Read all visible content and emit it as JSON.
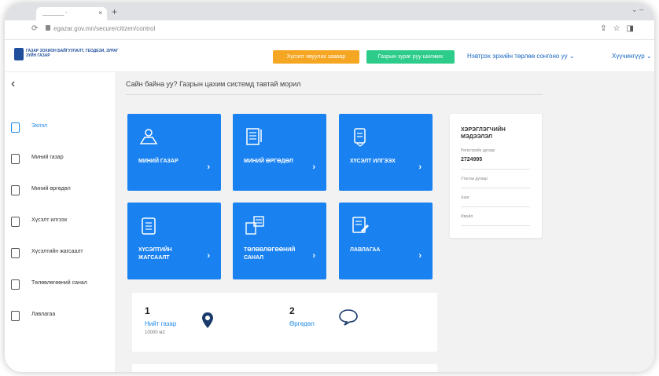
{
  "browser": {
    "tab_title": "_______ - ",
    "tab_close": "×",
    "new_tab": "+",
    "window_controls": "⌄ –",
    "url": "egazar.gov.mn/secure/citizen/control",
    "reload_icon": "reload-icon"
  },
  "header": {
    "logo_text": "ГАЗАР ЗОХИОН БАЙГУУЛАЛТ, ГЕОДЕЗИ, ЗУРАГ ЗҮЙН ГАЗАР",
    "btn_orange": "Хүсэлт явуулах заавар",
    "btn_green": "Газрын зураг руу шилжих",
    "link_participate": "Нэвтрэх эрхийн төрлөө сонгоно уу",
    "link_user": "Хүүчингүүр",
    "accent_orange": "#f5a623",
    "accent_green": "#2ecc8a",
    "accent_blue": "#1a82f0"
  },
  "sidebar": {
    "back_icon": "back-arrow-icon",
    "items": [
      {
        "label": "Эхлэл",
        "icon": "home-icon",
        "active": true
      },
      {
        "label": "Миний газар",
        "icon": "map-icon",
        "active": false
      },
      {
        "label": "Миний өргөдөл",
        "icon": "document-icon",
        "active": false
      },
      {
        "label": "Хүсэлт илгээх",
        "icon": "send-icon",
        "active": false
      },
      {
        "label": "Хүсэлтийн жагсаалт",
        "icon": "list-icon",
        "active": false
      },
      {
        "label": "Төлөвлөгөөний санал",
        "icon": "plan-icon",
        "active": false
      },
      {
        "label": "Лавлагаа",
        "icon": "reference-icon",
        "active": false
      }
    ]
  },
  "main": {
    "welcome": "Сайн байна уу? Газрын цахим системд тавтай морил",
    "tiles": [
      {
        "label": "МИНИЙ ГАЗАР",
        "icon": "land-icon"
      },
      {
        "label": "МИНИЙ ӨРГӨДӨЛ",
        "icon": "application-icon"
      },
      {
        "label": "ХҮСЭЛТ ИЛГЭЭХ",
        "icon": "submit-icon"
      },
      {
        "label": "ХҮСЭЛТИЙН ЖАГСААЛТ",
        "icon": "request-list-icon"
      },
      {
        "label": "ТӨЛӨВЛӨГӨӨНИЙ САНАЛ",
        "icon": "plan-proposal-icon"
      },
      {
        "label": "ЛАВЛАГАА",
        "icon": "reference-doc-icon"
      }
    ],
    "user_card": {
      "title": "ХЭРЭГЛЭГЧИЙН МЭДЭЭЛЭЛ",
      "reg_label": "Регистрийн дугаар",
      "reg_value": "2724995",
      "phone_label": "Утасны дугаар",
      "address_label": "Хаяг",
      "email_label": "Имэйл"
    },
    "stats": [
      {
        "number": "1",
        "label": "Нийт газар",
        "sub": "10000 м2",
        "icon": "location-pin-icon"
      },
      {
        "number": "2",
        "label": "Өргөдөл",
        "sub": "",
        "icon": "chat-bubble-icon"
      }
    ]
  }
}
